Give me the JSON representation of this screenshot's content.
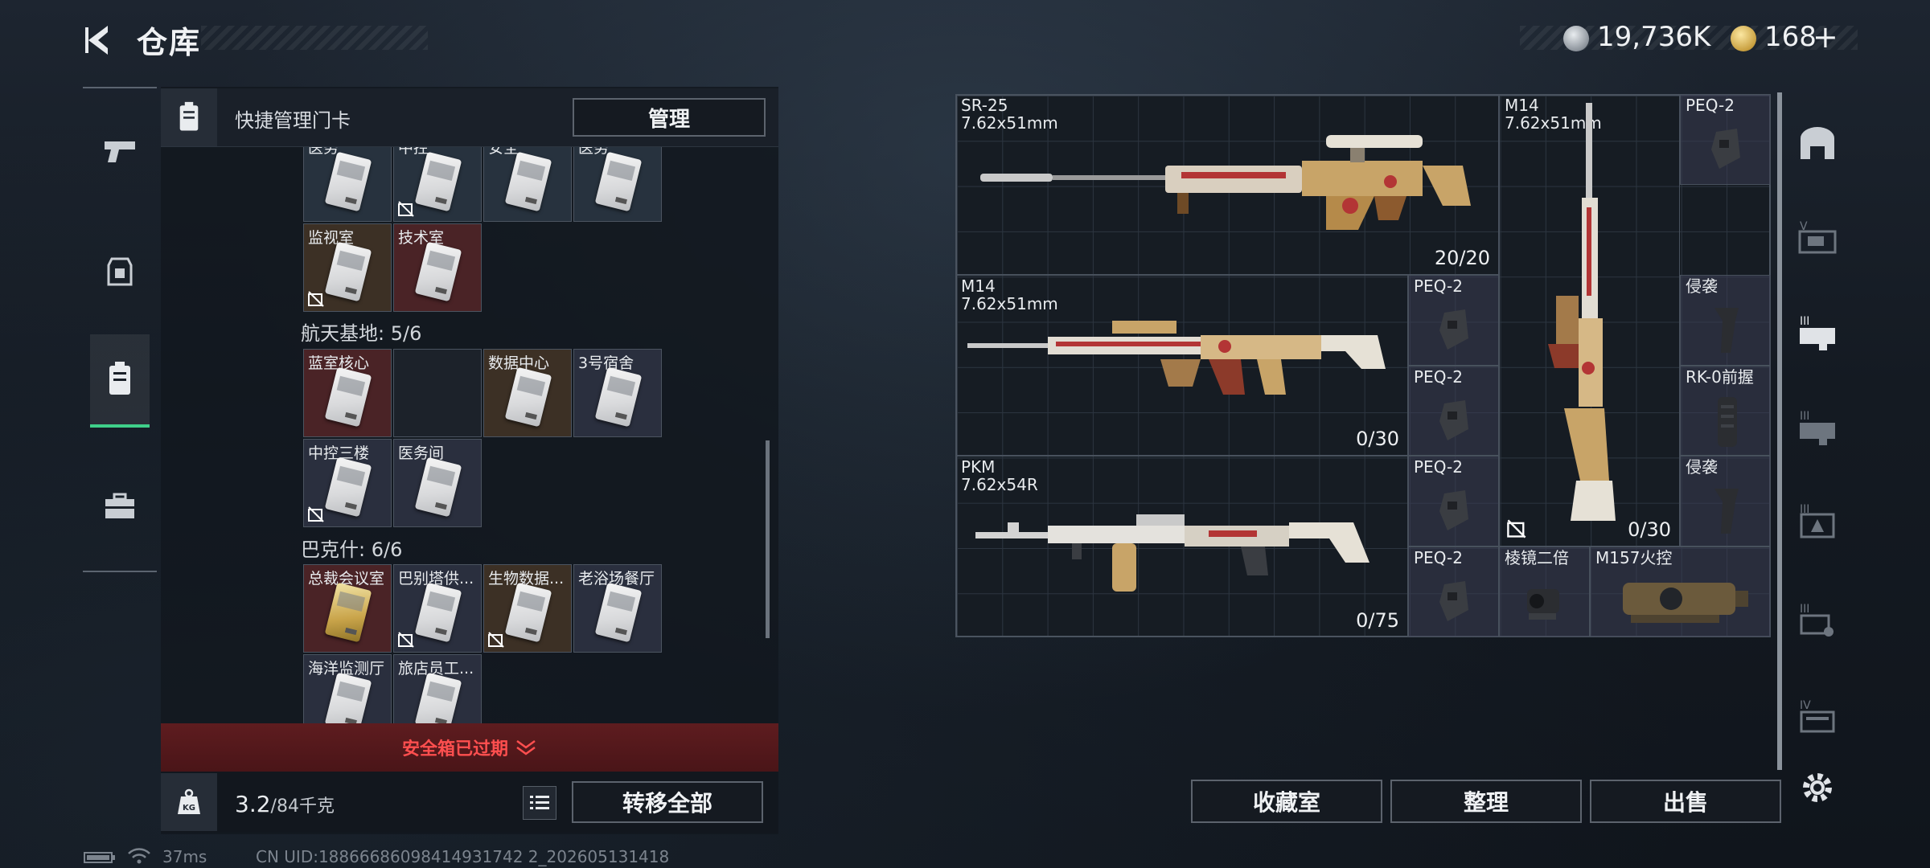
{
  "header": {
    "title": "仓库"
  },
  "currency": {
    "silver": "19,736K",
    "gold": "168",
    "gold_add": "+"
  },
  "quick_bar": {
    "label": "快捷管理门卡",
    "manage_btn": "管理"
  },
  "sections": {
    "aerospace": "航天基地: 5/6",
    "bakesh": "巴克什: 6/6"
  },
  "cards": {
    "row0": [
      "医务",
      "中控",
      "安全",
      "医务"
    ],
    "monitor": "监视室",
    "tech": "技术室",
    "blue_core": "蓝室核心",
    "data_center": "数据中心",
    "dorm3": "3号宿舍",
    "ctrl3": "中控三楼",
    "medical": "医务间",
    "ceo": "总裁会议室",
    "babel": "巴别塔供...",
    "bio": "生物数据...",
    "laoyu": "老浴场餐厅",
    "ocean": "海洋监测厅",
    "hotel": "旅店员工..."
  },
  "safebox": {
    "status": "安全箱已过期"
  },
  "storage": {
    "weight": "3.2",
    "capacity": "/84千克",
    "transfer_btn": "转移全部"
  },
  "weapons": {
    "sr25": {
      "name": "SR-25",
      "caliber": "7.62x51mm",
      "ammo": "20/20"
    },
    "m14a": {
      "name": "M14",
      "caliber": "7.62x51mm",
      "ammo": "0/30"
    },
    "m14b": {
      "name": "M14",
      "caliber": "7.62x51mm",
      "ammo": "0/30"
    },
    "pkm": {
      "name": "PKM",
      "caliber": "7.62x54R",
      "ammo": "0/75"
    }
  },
  "attachments": {
    "peq1": "PEQ-2",
    "peq2": "PEQ-2",
    "peq3": "PEQ-2",
    "peq4": "PEQ-2",
    "peq5": "PEQ-2",
    "qinxi1": "侵袭",
    "rk0": "RK-0前握",
    "qinxi2": "侵袭",
    "prism": "棱镜二倍",
    "m157": "M157火控"
  },
  "right_buttons": {
    "collection": "收藏室",
    "sort": "整理",
    "sell": "出售"
  },
  "right_tabs": {
    "t2": "V",
    "t3": "III",
    "t4": "III",
    "t5": "III",
    "t6": "III",
    "t7": "IV"
  },
  "status": {
    "ping": "37ms",
    "uid": "CN UID:18866686098414931742 2_202605131418"
  },
  "colors": {
    "accent": "#3fd08a",
    "warning": "#ff4f4f"
  }
}
